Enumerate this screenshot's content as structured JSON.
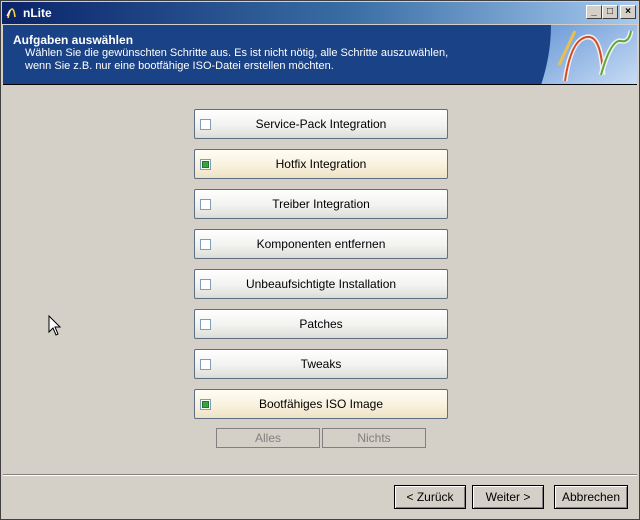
{
  "window": {
    "title": "nLite",
    "minimize_glyph": "_",
    "maximize_glyph": "□",
    "close_glyph": "×"
  },
  "header": {
    "title": "Aufgaben auswählen",
    "description_line1": "Wählen Sie die gewünschten Schritte aus. Es ist nicht nötig, alle Schritte auszuwählen,",
    "description_line2": "wenn Sie z.B. nur eine bootfähige ISO-Datei erstellen möchten."
  },
  "tasks": [
    {
      "label": "Service-Pack Integration",
      "checked": false
    },
    {
      "label": "Hotfix Integration",
      "checked": true
    },
    {
      "label": "Treiber Integration",
      "checked": false
    },
    {
      "label": "Komponenten entfernen",
      "checked": false
    },
    {
      "label": "Unbeaufsichtigte Installation",
      "checked": false
    },
    {
      "label": "Patches",
      "checked": false
    },
    {
      "label": "Tweaks",
      "checked": false
    },
    {
      "label": "Bootfähiges ISO Image",
      "checked": true
    }
  ],
  "selection": {
    "all_label": "Alles",
    "none_label": "Nichts"
  },
  "navigation": {
    "back_label": "< Zurück",
    "next_label": "Weiter >",
    "cancel_label": "Abbrechen"
  },
  "colors": {
    "header_bg": "#1a4286",
    "checked_green": "#3aa53a",
    "window_bg": "#d4d0c8"
  }
}
